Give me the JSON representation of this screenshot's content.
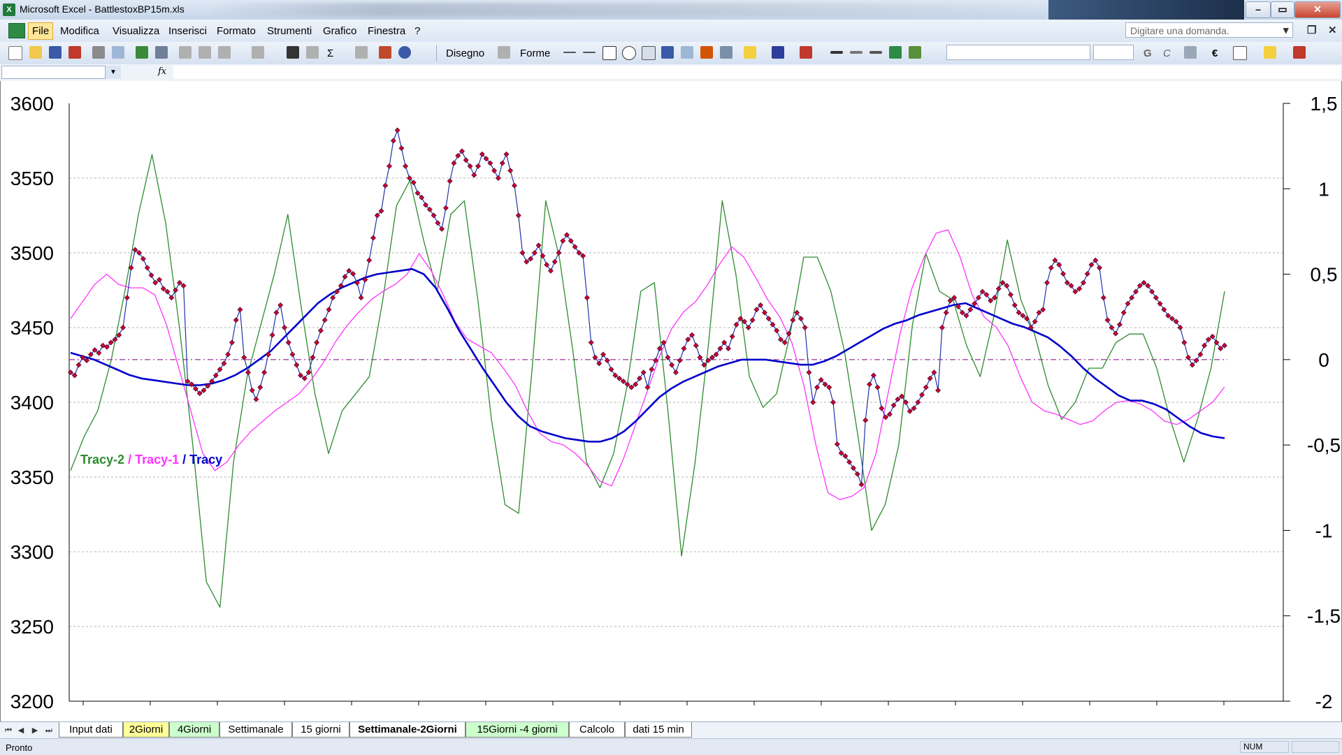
{
  "window": {
    "title": "Microsoft Excel - BattlestoxBP15m.xls",
    "app_icon": "X",
    "minimize": "–",
    "maximize": "▭",
    "close": "✕"
  },
  "menu": {
    "items": [
      "File",
      "Modifica",
      "Visualizza",
      "Inserisci",
      "Formato",
      "Strumenti",
      "Grafico",
      "Finestra",
      "?"
    ],
    "help_placeholder": "Digitare una domanda.",
    "restore_down": "▾",
    "restore": "❐",
    "close_doc": "✕"
  },
  "toolbar": {
    "draw_label": "Disegno",
    "shapes_label": "Forme",
    "sigma": "Σ",
    "bold": "G",
    "italic": "C",
    "euro": "€"
  },
  "formula_bar": {
    "fx": "fx"
  },
  "chart_data": {
    "type": "line",
    "left_axis": {
      "ylim": [
        3200,
        3600
      ],
      "ticks": [
        "3600",
        "3550",
        "3500",
        "3450",
        "3400",
        "3350",
        "3300",
        "3250",
        "3200"
      ]
    },
    "right_axis": {
      "ylim": [
        -2,
        1.5
      ],
      "ticks": [
        "1,5",
        "1",
        "0,5",
        "0",
        "-0,5",
        "-1",
        "-1,5",
        "-2"
      ]
    },
    "legend": [
      {
        "name": "Tracy-2",
        "color": "#2e8b2e"
      },
      {
        "name": "Tracy-1",
        "color": "#ff33ff"
      },
      {
        "name": "Tracy",
        "color": "#0000cc"
      }
    ],
    "legend_sep": " / ",
    "grid": true,
    "zero_line": true,
    "price_series": {
      "axis": "left",
      "color_line": "#2233aa",
      "color_marker": "#cc0033",
      "values": [
        3420,
        3418,
        3425,
        3430,
        3428,
        3432,
        3435,
        3433,
        3438,
        3437,
        3440,
        3442,
        3445,
        3450,
        3470,
        3490,
        3502,
        3500,
        3496,
        3490,
        3485,
        3480,
        3482,
        3476,
        3474,
        3470,
        3475,
        3480,
        3478,
        3414,
        3412,
        3409,
        3406,
        3408,
        3411,
        3414,
        3418,
        3422,
        3426,
        3432,
        3440,
        3455,
        3462,
        3430,
        3420,
        3408,
        3402,
        3410,
        3420,
        3432,
        3445,
        3460,
        3465,
        3450,
        3440,
        3432,
        3425,
        3418,
        3416,
        3420,
        3430,
        3440,
        3448,
        3455,
        3462,
        3470,
        3474,
        3478,
        3484,
        3488,
        3486,
        3480,
        3470,
        3482,
        3495,
        3510,
        3525,
        3528,
        3545,
        3558,
        3575,
        3582,
        3570,
        3558,
        3550,
        3547,
        3540,
        3537,
        3532,
        3529,
        3525,
        3520,
        3516,
        3530,
        3548,
        3560,
        3565,
        3568,
        3562,
        3558,
        3552,
        3558,
        3566,
        3563,
        3560,
        3555,
        3550,
        3560,
        3566,
        3555,
        3545,
        3525,
        3500,
        3494,
        3496,
        3500,
        3505,
        3498,
        3492,
        3488,
        3494,
        3500,
        3508,
        3512,
        3508,
        3504,
        3500,
        3498,
        3470,
        3440,
        3430,
        3426,
        3432,
        3428,
        3422,
        3418,
        3416,
        3414,
        3412,
        3410,
        3412,
        3416,
        3420,
        3410,
        3422,
        3428,
        3436,
        3440,
        3430,
        3425,
        3420,
        3428,
        3436,
        3442,
        3445,
        3438,
        3430,
        3425,
        3428,
        3430,
        3432,
        3436,
        3440,
        3436,
        3444,
        3452,
        3456,
        3454,
        3450,
        3455,
        3462,
        3465,
        3460,
        3456,
        3452,
        3448,
        3442,
        3440,
        3446,
        3455,
        3460,
        3456,
        3450,
        3420,
        3400,
        3410,
        3415,
        3412,
        3410,
        3400,
        3372,
        3366,
        3364,
        3360,
        3356,
        3352,
        3345,
        3388,
        3412,
        3418,
        3410,
        3396,
        3390,
        3392,
        3398,
        3402,
        3404,
        3400,
        3394,
        3396,
        3400,
        3405,
        3410,
        3416,
        3420,
        3408,
        3450,
        3460,
        3468,
        3470,
        3464,
        3460,
        3458,
        3462,
        3466,
        3470,
        3474,
        3472,
        3468,
        3470,
        3476,
        3480,
        3478,
        3472,
        3465,
        3460,
        3458,
        3456,
        3450,
        3454,
        3460,
        3462,
        3480,
        3490,
        3495,
        3492,
        3486,
        3480,
        3478,
        3474,
        3476,
        3480,
        3486,
        3492,
        3495,
        3490,
        3470,
        3455,
        3450,
        3446,
        3452,
        3460,
        3466,
        3470,
        3474,
        3478,
        3480,
        3478,
        3474,
        3470,
        3466,
        3462,
        3458,
        3456,
        3454,
        3450,
        3440,
        3430,
        3425,
        3428,
        3432,
        3438,
        3442,
        3444,
        3440,
        3436,
        3438
      ]
    },
    "tracy": {
      "axis": "right",
      "color": "#0000cc",
      "values": [
        0.04,
        0.02,
        0.0,
        -0.03,
        -0.06,
        -0.09,
        -0.11,
        -0.12,
        -0.13,
        -0.14,
        -0.15,
        -0.15,
        -0.14,
        -0.12,
        -0.09,
        -0.05,
        -0.0,
        0.05,
        0.12,
        0.19,
        0.26,
        0.33,
        0.38,
        0.42,
        0.45,
        0.48,
        0.5,
        0.51,
        0.52,
        0.53,
        0.5,
        0.42,
        0.3,
        0.17,
        0.06,
        -0.05,
        -0.15,
        -0.25,
        -0.33,
        -0.39,
        -0.42,
        -0.44,
        -0.46,
        -0.47,
        -0.48,
        -0.48,
        -0.46,
        -0.42,
        -0.36,
        -0.29,
        -0.22,
        -0.17,
        -0.13,
        -0.1,
        -0.07,
        -0.04,
        -0.02,
        0.0,
        0.0,
        0.0,
        -0.01,
        -0.02,
        -0.03,
        -0.03,
        -0.01,
        0.02,
        0.06,
        0.1,
        0.14,
        0.18,
        0.21,
        0.23,
        0.26,
        0.28,
        0.3,
        0.32,
        0.33,
        0.3,
        0.27,
        0.24,
        0.21,
        0.19,
        0.16,
        0.13,
        0.08,
        0.02,
        -0.05,
        -0.11,
        -0.16,
        -0.21,
        -0.24,
        -0.24,
        -0.26,
        -0.29,
        -0.34,
        -0.39,
        -0.43,
        -0.45,
        -0.46
      ]
    },
    "tracy1": {
      "axis": "right",
      "color": "#ff33ff",
      "values": [
        0.24,
        0.34,
        0.44,
        0.5,
        0.44,
        0.42,
        0.42,
        0.38,
        0.2,
        -0.05,
        -0.3,
        -0.55,
        -0.65,
        -0.6,
        -0.5,
        -0.42,
        -0.36,
        -0.3,
        -0.25,
        -0.2,
        -0.12,
        -0.02,
        0.1,
        0.2,
        0.28,
        0.35,
        0.4,
        0.44,
        0.5,
        0.62,
        0.52,
        0.38,
        0.22,
        0.12,
        0.08,
        0.04,
        -0.05,
        -0.15,
        -0.3,
        -0.43,
        -0.48,
        -0.5,
        -0.55,
        -0.62,
        -0.71,
        -0.74,
        -0.58,
        -0.38,
        -0.18,
        0.02,
        0.18,
        0.28,
        0.34,
        0.44,
        0.56,
        0.66,
        0.6,
        0.48,
        0.35,
        0.25,
        0.1,
        -0.15,
        -0.5,
        -0.78,
        -0.82,
        -0.8,
        -0.75,
        -0.55,
        -0.2,
        0.15,
        0.42,
        0.6,
        0.74,
        0.76,
        0.6,
        0.38,
        0.25,
        0.19,
        0.08,
        -0.1,
        -0.25,
        -0.3,
        -0.32,
        -0.35,
        -0.38,
        -0.36,
        -0.3,
        -0.25,
        -0.24,
        -0.26,
        -0.3,
        -0.36,
        -0.38,
        -0.35,
        -0.3,
        -0.25,
        -0.16
      ]
    },
    "tracy2": {
      "axis": "right",
      "color": "#2e8b2e",
      "values": [
        -0.65,
        -0.45,
        -0.3,
        0.0,
        0.4,
        0.85,
        1.2,
        0.8,
        0.2,
        -0.5,
        -1.3,
        -1.45,
        -0.6,
        -0.1,
        0.2,
        0.5,
        0.85,
        0.3,
        -0.2,
        -0.55,
        -0.3,
        -0.2,
        -0.1,
        0.35,
        0.9,
        1.05,
        0.7,
        0.4,
        0.85,
        0.93,
        0.35,
        -0.35,
        -0.85,
        -0.9,
        -0.05,
        0.93,
        0.6,
        0.05,
        -0.6,
        -0.75,
        -0.55,
        -0.15,
        0.4,
        0.45,
        -0.3,
        -1.15,
        -0.6,
        0.1,
        0.93,
        0.5,
        -0.1,
        -0.28,
        -0.2,
        0.15,
        0.6,
        0.6,
        0.4,
        0.05,
        -0.45,
        -1.0,
        -0.85,
        -0.5,
        0.2,
        0.62,
        0.4,
        0.35,
        0.08,
        -0.1,
        0.25,
        0.7,
        0.35,
        0.15,
        -0.15,
        -0.35,
        -0.25,
        -0.05,
        -0.05,
        0.1,
        0.15,
        0.15,
        -0.05,
        -0.35,
        -0.6,
        -0.35,
        -0.05,
        0.4
      ]
    }
  },
  "sheet_nav": [
    "⏮",
    "◀",
    "▶",
    "⏭"
  ],
  "sheet_tabs": [
    "Input dati",
    "2Giorni",
    "4Giorni",
    "Settimanale",
    "15 giorni",
    "Settimanale-2Giorni",
    "15Giorni -4 giorni",
    "Calcolo",
    "dati 15 min"
  ],
  "status": {
    "left": "Pronto",
    "num": "NUM"
  }
}
